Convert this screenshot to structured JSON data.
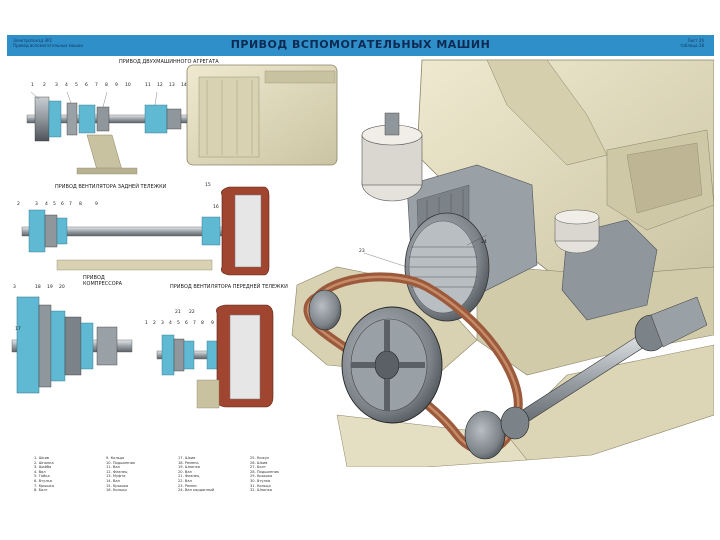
{
  "poster": {
    "title": "ПРИВОД ВСПОМОГАТЕЛЬНЫХ МАШИН",
    "header_left": [
      "Электропоезд ЭР2",
      "Привод вспомогательных машин"
    ],
    "header_right": [
      "Лист 26",
      "таблица 28"
    ],
    "sections": {
      "top": "ПРИВОД ДВУХМАШИННОГО АГРЕГАТА",
      "rear_truck": "ПРИВОД ВЕНТИЛЯТОРА ЗАДНЕЙ ТЕЛЕЖКИ",
      "compressor": "ПРИВОД КОМПРЕССОРА",
      "front_truck": "ПРИВОД ВЕНТИЛЯТОРА ПЕРЕДНЕЙ ТЕЛЕЖКИ"
    },
    "top_numbers": [
      "1",
      "2",
      "3",
      "4",
      "5",
      "6",
      "7",
      "8",
      "9",
      "10",
      "11",
      "12",
      "13",
      "14"
    ],
    "rear_numbers": [
      "2",
      "3",
      "4",
      "5",
      "6",
      "7",
      "8",
      "9",
      "15",
      "16"
    ],
    "compressor_numbers": [
      "3",
      "18",
      "19",
      "20",
      "17"
    ],
    "front_numbers": [
      "1",
      "2",
      "3",
      "4",
      "5",
      "6",
      "7",
      "8",
      "9",
      "21",
      "22"
    ],
    "main_numbers": [
      "23",
      "24"
    ],
    "legend": [
      [
        "1. Шкив",
        "2. Шпонка",
        "3. Шайба",
        "4. Вал",
        "5. Гайка",
        "6. Втулка",
        "7. Крышка",
        "8. Болт"
      ],
      [
        "9. Кольцо",
        "10. Подшипник",
        "11. Вал",
        "12. Фланец",
        "13. Муфта",
        "14. Вал",
        "15. Крышка",
        "16. Кольцо"
      ],
      [
        "17. Шкив",
        "18. Ремень",
        "19. Шпонка",
        "20. Вал",
        "21. Фланец",
        "22. Вал",
        "23. Ремни",
        "24. Вал карданный"
      ],
      [
        "25. Кожух",
        "26. Шкив",
        "27. Болт",
        "28. Подшипник",
        "29. Крышка",
        "30. Втулка",
        "31. Кольцо",
        "32. Шпонка"
      ]
    ],
    "colors": {
      "title_bar": "#2f8fc9",
      "title_text": "#0d2a52",
      "cream_machine": "#e2dcc0",
      "cream_shadow": "#c4bd9c",
      "steel": "#8f969c",
      "steel_dark": "#5a6066",
      "belt": "#9b5a3c",
      "brick_red": "#a0452f",
      "cyan_section": "#5fb9d3"
    }
  }
}
